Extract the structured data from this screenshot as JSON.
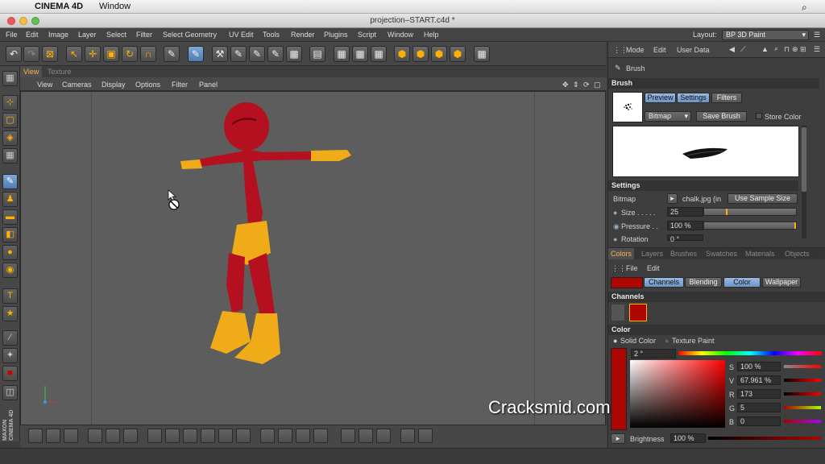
{
  "macbar": {
    "app": "CINEMA 4D",
    "menu": "Window"
  },
  "window": {
    "title": "projection–START.c4d *"
  },
  "menu": {
    "items": [
      "File",
      "Edit",
      "Image",
      "Layer",
      "Select",
      "Filter",
      "Select Geometry",
      "UV Edit",
      "Tools",
      "Render",
      "Plugins",
      "Script",
      "Window",
      "Help"
    ],
    "layout_label": "Layout:",
    "layout_value": "BP 3D Paint"
  },
  "viewport": {
    "tabs": [
      "View",
      "Texture"
    ],
    "menu": [
      "View",
      "Cameras",
      "Display",
      "Options",
      "Filter",
      "Panel"
    ]
  },
  "attributes": {
    "menu": [
      "Mode",
      "Edit",
      "User Data"
    ],
    "object": "Brush",
    "section": "Brush",
    "tabs": [
      "Preview",
      "Settings",
      "Filters"
    ],
    "bitmap_mode": "Bitmap",
    "save_brush": "Save Brush",
    "store_color": "Store Color",
    "settings_title": "Settings",
    "bitmap_label": "Bitmap",
    "bitmap_file": "chalk.jpg (in",
    "use_sample": "Use Sample Size",
    "size_label": "Size . . . . .",
    "size_value": "25",
    "pressure_label": "Pressure . .",
    "pressure_value": "100 %",
    "rotation_label": "Rotation",
    "rotation_value": "0 °"
  },
  "colors": {
    "tabs": [
      "Colors",
      "Layers",
      "Brushes",
      "Swatches",
      "Materials",
      "Objects"
    ],
    "menu": [
      "File",
      "Edit"
    ],
    "channel_tabs": [
      "Channels",
      "Blending",
      "Color",
      "Wallpaper"
    ],
    "channels_title": "Channels",
    "color_title": "Color",
    "solid_color": "Solid Color",
    "texture_paint": "Texture Paint",
    "hue": "2 °",
    "s_label": "S",
    "s_value": "100 %",
    "v_label": "V",
    "v_value": "67.961 %",
    "r_label": "R",
    "r_value": "173",
    "g_label": "G",
    "g_value": "5",
    "b_label": "B",
    "b_value": "0",
    "brightness_label": "Brightness",
    "brightness_value": "100 %",
    "current_color": "#ad0500"
  },
  "watermark": "Cracksmid.com",
  "side_text": "MAXON CINEMA 4D"
}
